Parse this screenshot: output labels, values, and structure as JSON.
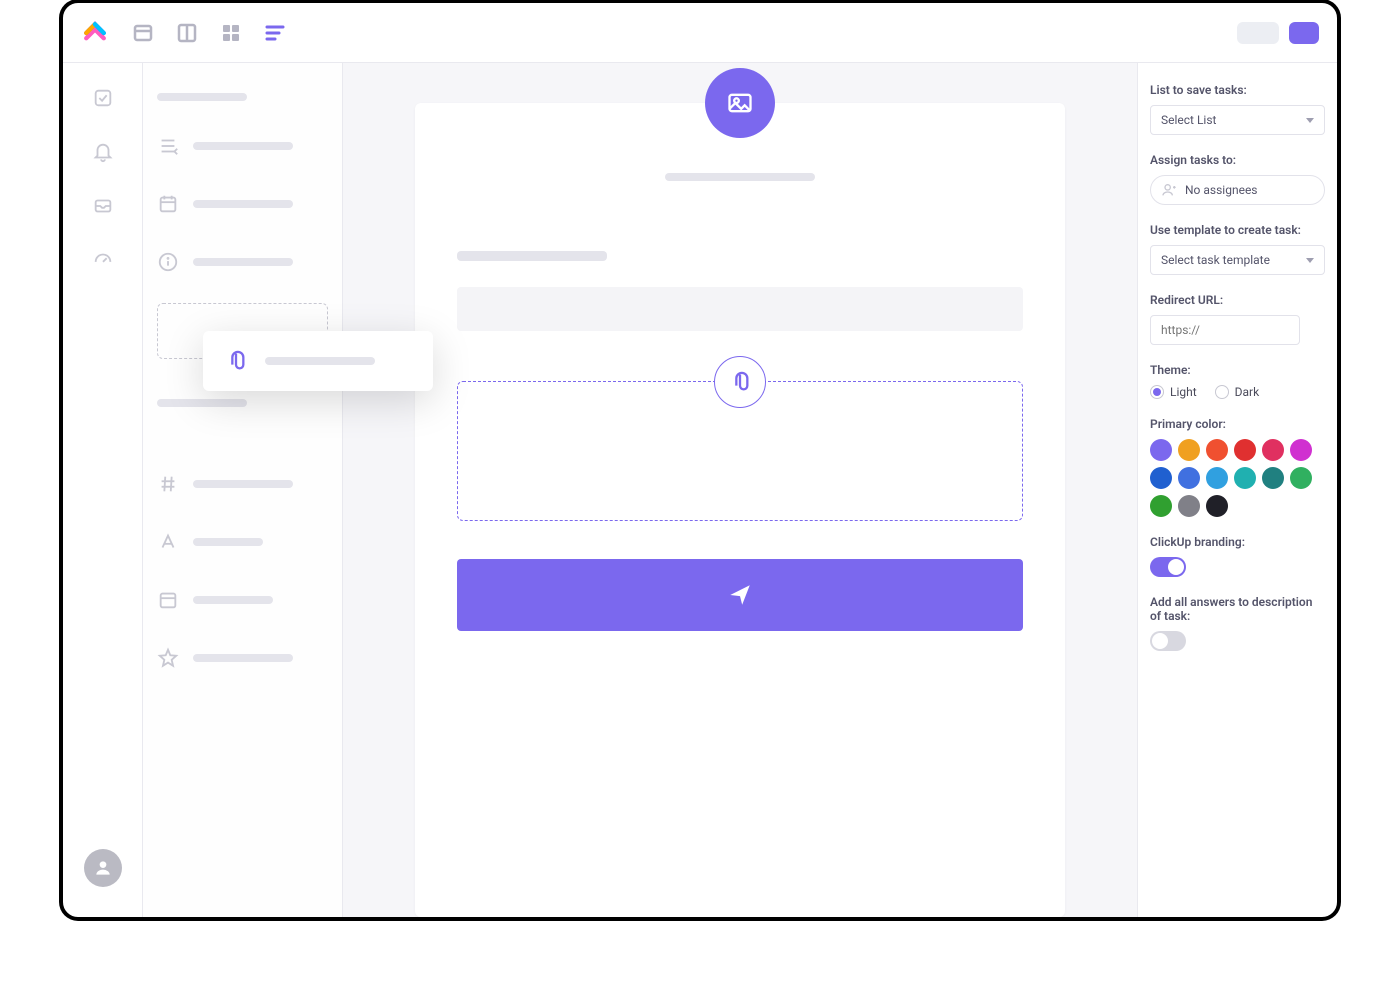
{
  "settings": {
    "listLabel": "List to save tasks:",
    "listSelect": "Select List",
    "assignLabel": "Assign tasks to:",
    "assignValue": "No assignees",
    "templateLabel": "Use template to create task:",
    "templateSelect": "Select task template",
    "redirectLabel": "Redirect URL:",
    "redirectPlaceholder": "https://",
    "themeLabel": "Theme:",
    "themeLight": "Light",
    "themeDark": "Dark",
    "primaryColorLabel": "Primary color:",
    "brandingLabel": "ClickUp branding:",
    "answersLabel": "Add all answers to description of task:"
  },
  "colors": [
    "#7B68EE",
    "#f0a020",
    "#f05030",
    "#e03030",
    "#e03060",
    "#d030d0",
    "#2060d0",
    "#4070e0",
    "#30a0e0",
    "#20b0b0",
    "#208080",
    "#30b060",
    "#30a030",
    "#808088",
    "#202028"
  ],
  "toggles": {
    "branding": true,
    "answers": false
  },
  "theme": "light"
}
